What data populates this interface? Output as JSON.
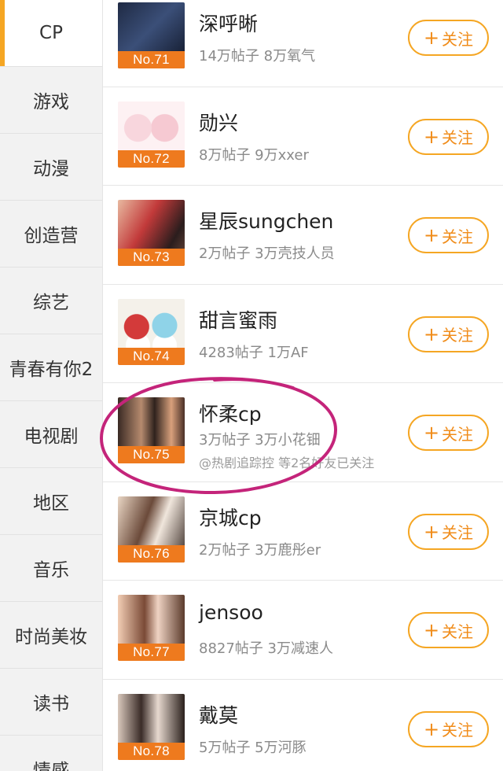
{
  "sidebar": {
    "items": [
      {
        "label": "CP",
        "active": true
      },
      {
        "label": "游戏"
      },
      {
        "label": "动漫"
      },
      {
        "label": "创造营"
      },
      {
        "label": "综艺"
      },
      {
        "label": "青春有你2"
      },
      {
        "label": "电视剧"
      },
      {
        "label": "地区"
      },
      {
        "label": "音乐"
      },
      {
        "label": "时尚美妆"
      },
      {
        "label": "读书"
      },
      {
        "label": "情感"
      }
    ]
  },
  "list": {
    "follow_label": "关注",
    "follow_icon": "plus-icon",
    "items": [
      {
        "rank": "No.71",
        "name": "深呼晰",
        "stats": "14万帖子 8万氧气"
      },
      {
        "rank": "No.72",
        "name": "勋兴",
        "stats": "8万帖子 9万xxer"
      },
      {
        "rank": "No.73",
        "name": "星辰sungchen",
        "stats": "2万帖子 3万壳技人员"
      },
      {
        "rank": "No.74",
        "name": "甜言蜜雨",
        "stats": "4283帖子 1万AF"
      },
      {
        "rank": "No.75",
        "name": "怀柔cp",
        "stats": "3万帖子 3万小花钿",
        "friends": "@热剧追踪控 等2名好友已关注"
      },
      {
        "rank": "No.76",
        "name": "京城cp",
        "stats": "2万帖子 3万鹿彤er"
      },
      {
        "rank": "No.77",
        "name": "jensoo",
        "stats": "8827帖子 3万减速人"
      },
      {
        "rank": "No.78",
        "name": "戴莫",
        "stats": "5万帖子 5万河豚"
      }
    ]
  },
  "colors": {
    "accent": "#f5a623",
    "rank_badge": "#ee7a1e",
    "annotation_circle": "#c4247a"
  }
}
